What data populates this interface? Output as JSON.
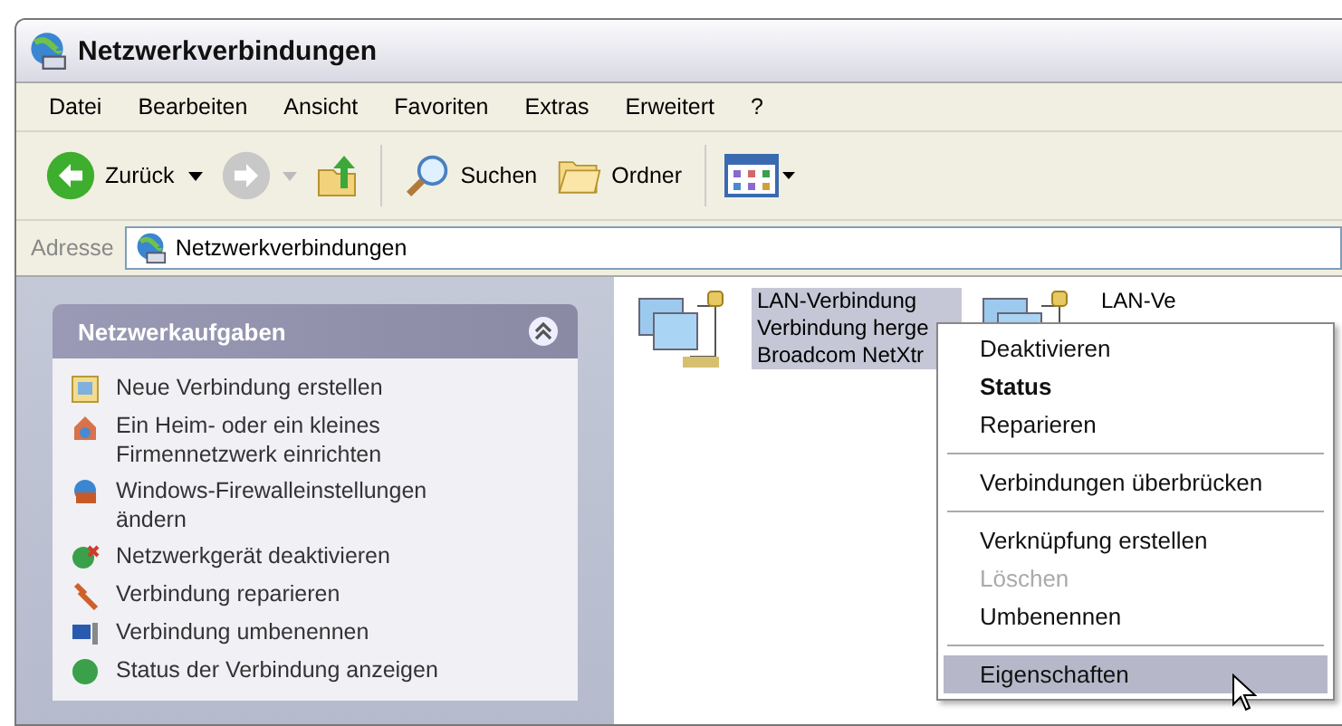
{
  "window": {
    "title": "Netzwerkverbindungen"
  },
  "menu_bar": [
    "Datei",
    "Bearbeiten",
    "Ansicht",
    "Favoriten",
    "Extras",
    "Erweitert",
    "?"
  ],
  "toolbar": {
    "back": "Zurück",
    "search": "Suchen",
    "folders": "Ordner"
  },
  "address_bar": {
    "label": "Adresse",
    "value": "Netzwerkverbindungen"
  },
  "task_panel": {
    "title": "Netzwerkaufgaben",
    "expanded": true,
    "items": [
      {
        "kind": "new",
        "lines": [
          "Neue Verbindung erstellen"
        ]
      },
      {
        "kind": "home",
        "lines": [
          "Ein Heim- oder ein kleines",
          "Firmennetzwerk einrichten"
        ]
      },
      {
        "kind": "firewall",
        "lines": [
          "Windows-Firewalleinstellungen",
          "ändern"
        ]
      },
      {
        "kind": "disable",
        "lines": [
          "Netzwerkgerät deaktivieren"
        ]
      },
      {
        "kind": "repair",
        "lines": [
          "Verbindung reparieren"
        ]
      },
      {
        "kind": "rename",
        "lines": [
          "Verbindung umbenennen"
        ]
      },
      {
        "kind": "status",
        "lines": [
          "Status der Verbindung anzeigen"
        ]
      }
    ]
  },
  "connections": [
    {
      "selected": true,
      "lines": [
        "LAN-Verbindung",
        "Verbindung herge",
        "Broadcom NetXtr"
      ]
    },
    {
      "selected": false,
      "lines": [
        "LAN-Ve"
      ]
    }
  ],
  "context_menu": [
    {
      "kind": "item",
      "label": "Deaktivieren",
      "bold": false,
      "disabled": false,
      "selected": false
    },
    {
      "kind": "item",
      "label": "Status",
      "bold": true,
      "disabled": false,
      "selected": false
    },
    {
      "kind": "item",
      "label": "Reparieren",
      "bold": false,
      "disabled": false,
      "selected": false
    },
    {
      "kind": "separator"
    },
    {
      "kind": "item",
      "label": "Verbindungen überbrücken",
      "bold": false,
      "disabled": false,
      "selected": false
    },
    {
      "kind": "separator"
    },
    {
      "kind": "item",
      "label": "Verknüpfung erstellen",
      "bold": false,
      "disabled": false,
      "selected": false
    },
    {
      "kind": "item",
      "label": "Löschen",
      "bold": false,
      "disabled": true,
      "selected": false
    },
    {
      "kind": "item",
      "label": "Umbenennen",
      "bold": false,
      "disabled": false,
      "selected": false
    },
    {
      "kind": "separator"
    },
    {
      "kind": "item",
      "label": "Eigenschaften",
      "bold": false,
      "disabled": false,
      "selected": true
    }
  ]
}
